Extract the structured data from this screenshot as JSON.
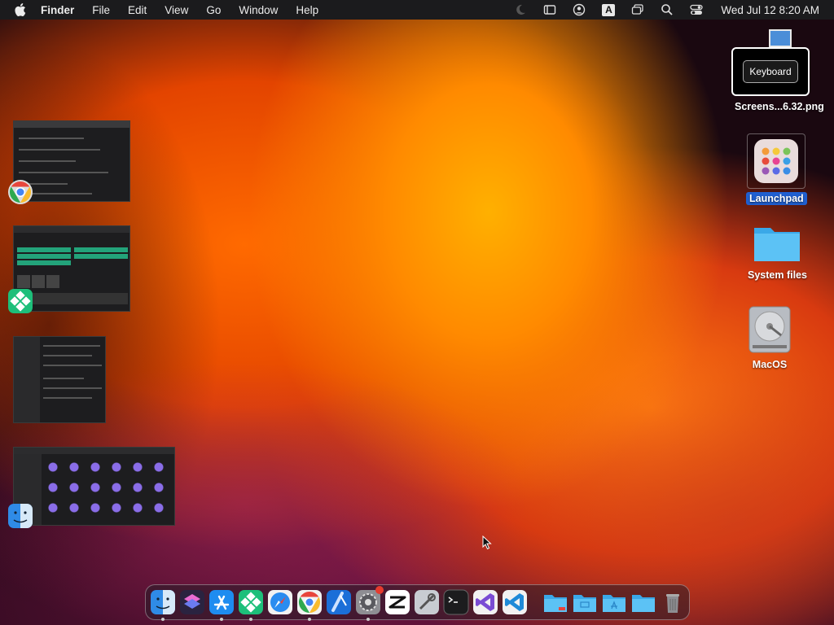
{
  "menubar": {
    "app_name": "Finder",
    "menus": [
      "File",
      "Edit",
      "View",
      "Go",
      "Window",
      "Help"
    ],
    "input_source": "A",
    "clock": "Wed Jul 12  8:20 AM",
    "status_icons": [
      "moon-icon",
      "sidebar-icon",
      "user-icon",
      "input-source-icon",
      "screens-icon",
      "search-icon",
      "control-center-icon"
    ]
  },
  "desktop": {
    "tooltip": "Keyboard",
    "icons": [
      {
        "label": "Screens...6.32.png",
        "icon": "screenshot-file-icon"
      },
      {
        "label": "Launchpad",
        "icon": "launchpad-icon",
        "selected": true
      },
      {
        "label": "System files",
        "icon": "folder-icon"
      },
      {
        "label": "MacOS",
        "icon": "hard-drive-icon"
      }
    ]
  },
  "stage_manager": {
    "groups": [
      {
        "app": "Google Chrome",
        "icon": "chrome-icon"
      },
      {
        "app": "Android Studio-like app",
        "icon": "green-diamond-app-icon"
      },
      {
        "app": "Settings window",
        "icon": "none"
      },
      {
        "app": "Finder",
        "icon": "finder-icon"
      }
    ]
  },
  "dock": {
    "apps": [
      {
        "name": "Finder",
        "icon": "finder-icon",
        "running": true
      },
      {
        "name": "Shortcuts",
        "icon": "shortcuts-icon",
        "running": false
      },
      {
        "name": "App Store",
        "icon": "app-store-icon",
        "running": true
      },
      {
        "name": "Green App",
        "icon": "green-diamond-app-icon",
        "running": true
      },
      {
        "name": "Safari",
        "icon": "safari-icon",
        "running": false
      },
      {
        "name": "Chrome",
        "icon": "chrome-icon",
        "running": true
      },
      {
        "name": "Xcode",
        "icon": "xcode-icon",
        "running": false
      },
      {
        "name": "System Settings",
        "icon": "settings-icon",
        "running": true,
        "badge": true
      },
      {
        "name": "CapCut",
        "icon": "capcut-icon",
        "running": false
      },
      {
        "name": "Utility",
        "icon": "utility-icon",
        "running": false
      },
      {
        "name": "Terminal",
        "icon": "terminal-icon",
        "running": false
      },
      {
        "name": "Visual Studio",
        "icon": "visual-studio-icon",
        "running": false
      },
      {
        "name": "VS Code",
        "icon": "vscode-icon",
        "running": false
      }
    ],
    "folders": [
      {
        "name": "Downloads",
        "icon": "folder-icon"
      },
      {
        "name": "Documents",
        "icon": "folder-icon"
      },
      {
        "name": "Applications",
        "icon": "folder-icon"
      },
      {
        "name": "Folder",
        "icon": "folder-icon"
      },
      {
        "name": "Trash",
        "icon": "trash-icon"
      }
    ]
  }
}
